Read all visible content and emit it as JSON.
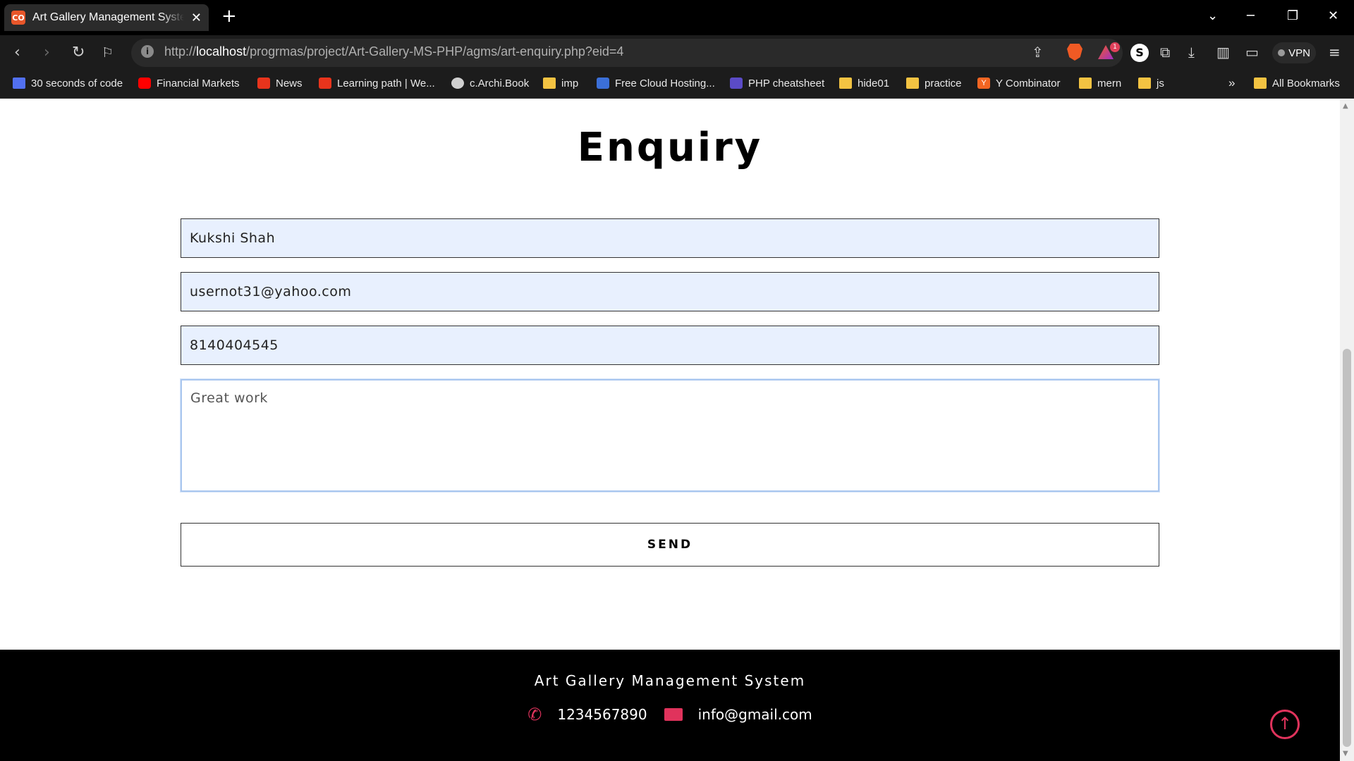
{
  "browser": {
    "tab_title": "Art Gallery Management System",
    "favicon_text": "CO",
    "url_prefix": "http://",
    "url_host": "localhost",
    "url_path": "/progrmas/project/Art-Gallery-MS-PHP/agms/art-enquiry.php?eid=4",
    "rewards_badge": "1",
    "profile_initial": "S",
    "vpn_label": "VPN",
    "bookmarks": [
      {
        "label": "30 seconds of code",
        "icon": "thirty-seconds-icon"
      },
      {
        "label": "Financial Markets",
        "icon": "youtube-icon"
      },
      {
        "label": "News",
        "icon": "news-icon"
      },
      {
        "label": "Learning path | We...",
        "icon": "learning-icon"
      },
      {
        "label": "c.Archi.Book",
        "icon": "globe-icon"
      },
      {
        "label": "imp",
        "icon": "folder-icon"
      },
      {
        "label": "Free Cloud Hosting...",
        "icon": "cloud-hosting-icon"
      },
      {
        "label": "PHP cheatsheet",
        "icon": "php-icon"
      },
      {
        "label": "hide01",
        "icon": "folder-icon"
      },
      {
        "label": "practice",
        "icon": "folder-icon"
      },
      {
        "label": "Y Combinator",
        "icon": "ycombinator-icon"
      },
      {
        "label": "mern",
        "icon": "folder-icon"
      },
      {
        "label": "js",
        "icon": "folder-icon"
      }
    ],
    "overflow_label": "»",
    "all_bookmarks": "All Bookmarks"
  },
  "page": {
    "heading": "Enquiry",
    "form": {
      "name_value": "Kukshi Shah",
      "email_value": "usernot31@yahoo.com",
      "phone_value": "8140404545",
      "message_value": "Great work",
      "send_label": "SEND"
    },
    "footer": {
      "title": "Art Gallery Management System",
      "phone": "1234567890",
      "email": "info@gmail.com"
    }
  },
  "colors": {
    "accent": "#e0335c",
    "input_autofill_bg": "#e8f0fe",
    "footer_bg": "#000000"
  }
}
